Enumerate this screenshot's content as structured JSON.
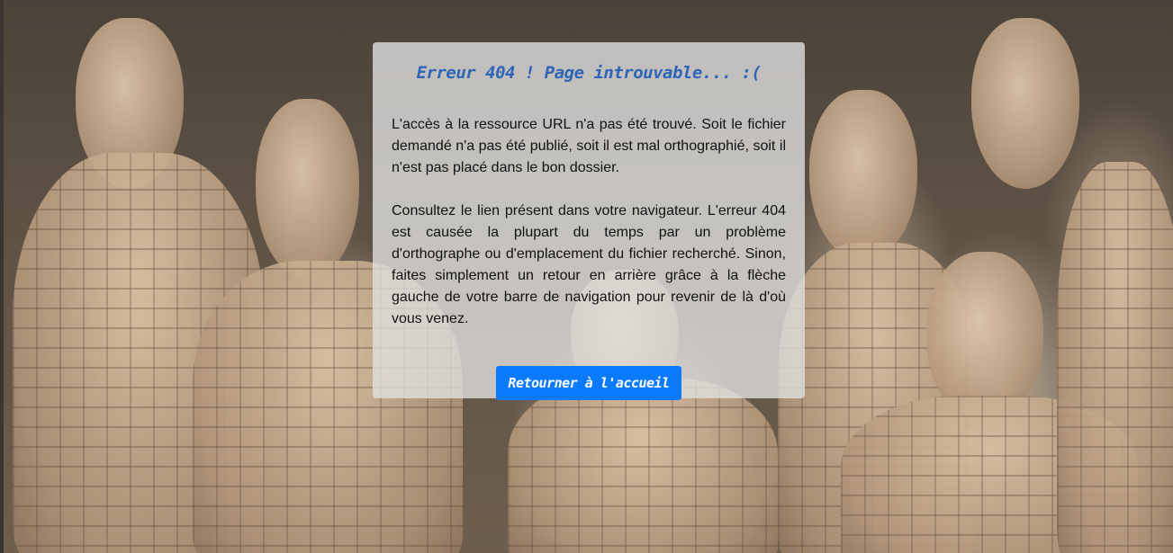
{
  "background": {
    "icon": "terracotta-warriors-photo"
  },
  "error_panel": {
    "title": "Erreur 404 ! Page introuvable... :(",
    "paragraph_1": "L'accès à la ressource URL n'a pas été trouvé. Soit le fichier demandé n'a pas été publié, soit il est mal orthographié, soit il n'est pas placé dans le bon dossier.",
    "paragraph_2": "Consultez le lien présent dans votre navigateur. L'erreur 404 est causée la plupart du temps par un problème d'orthographe ou d'emplacement du fichier recherché. Sinon, faites simplement un retour en arrière grâce à la flèche gauche de votre barre de navigation pour revenir de là d'où vous venez.",
    "home_button_label": "Retourner à l'accueil"
  },
  "colors": {
    "title": "#2e65b8",
    "button_bg": "#0a7bff",
    "button_text": "#ffffff"
  }
}
